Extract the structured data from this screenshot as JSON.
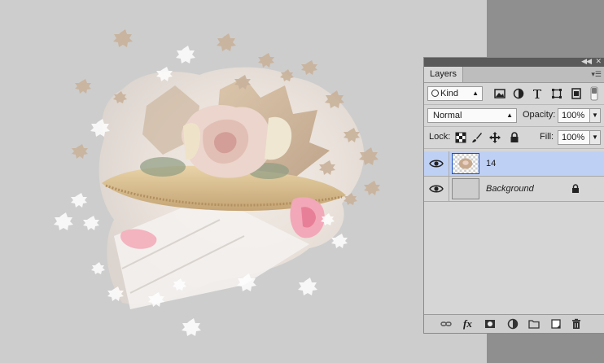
{
  "panel": {
    "title": "Layers",
    "collapse_icon": "double-left-arrow-icon",
    "close_icon": "close-icon",
    "menu_icon": "panel-menu-icon",
    "filter": {
      "label": "Kind"
    },
    "blend_mode": "Normal",
    "opacity_label": "Opacity:",
    "opacity_value": "100%",
    "lock_label": "Lock:",
    "fill_label": "Fill:",
    "fill_value": "100%",
    "layers": [
      {
        "name": "14",
        "visible": true,
        "selected": true
      },
      {
        "name": "Background",
        "visible": true,
        "selected": false,
        "locked": true
      }
    ],
    "bottom_icons": [
      "link-icon",
      "fx-icon",
      "mask-icon",
      "adjustment-icon",
      "folder-icon",
      "new-layer-icon",
      "trash-icon"
    ],
    "fx_label": "fx"
  },
  "colors": {
    "selected_row": "#bfd0f5",
    "pasteboard": "#8f8f8f",
    "canvas": "#cdcdcd"
  }
}
